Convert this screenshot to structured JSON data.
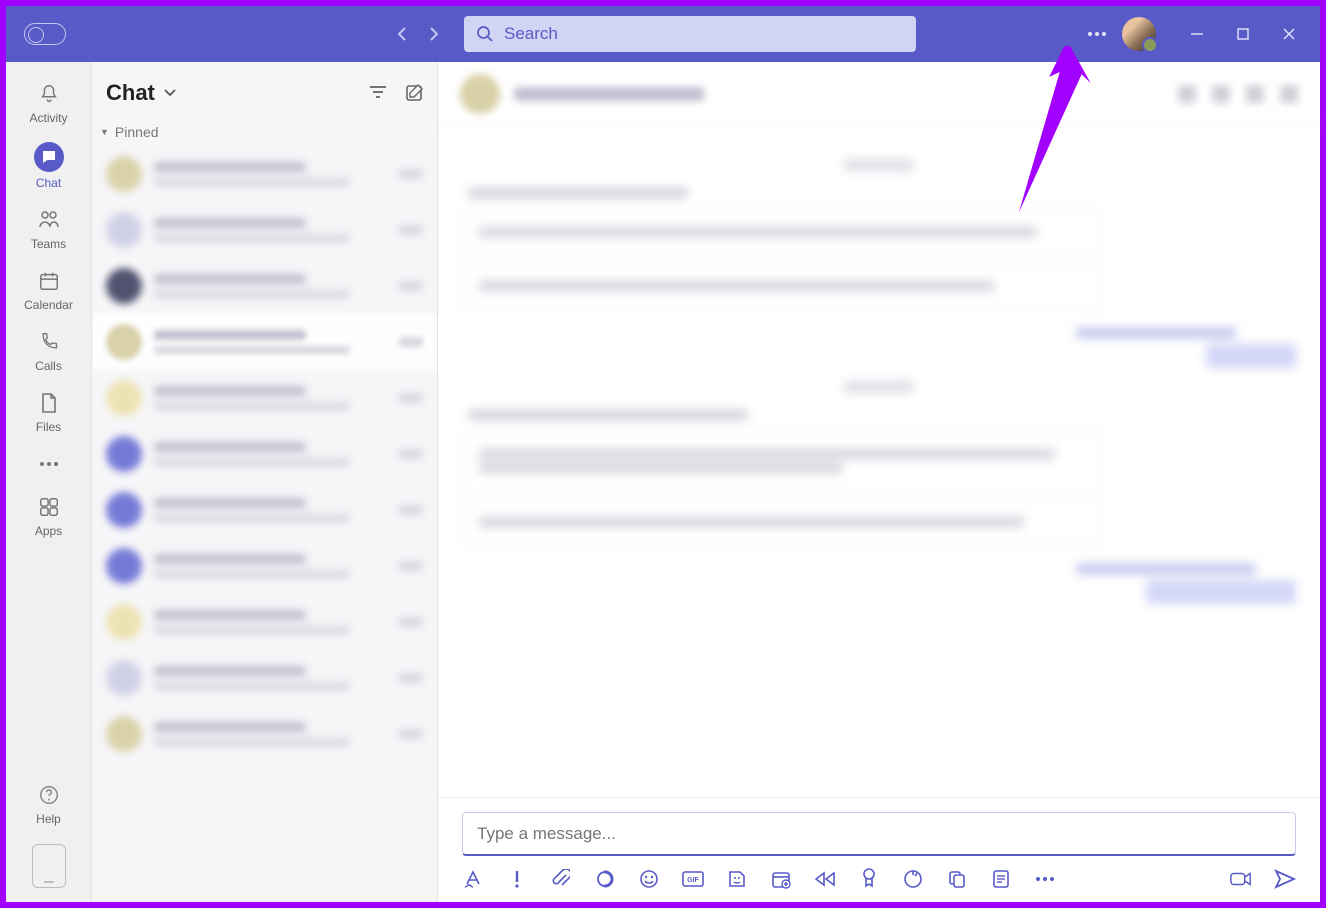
{
  "titlebar": {
    "search_placeholder": "Search",
    "more_dots": "⋅⋅⋅"
  },
  "rail": {
    "activity": "Activity",
    "chat": "Chat",
    "teams": "Teams",
    "calendar": "Calendar",
    "calls": "Calls",
    "files": "Files",
    "apps": "Apps",
    "help": "Help",
    "more": "•••"
  },
  "panel": {
    "title": "Chat",
    "section_pinned": "Pinned"
  },
  "compose": {
    "placeholder": "Type a message..."
  },
  "colors": {
    "brand": "#575ac7",
    "annotation": "#a100ff"
  }
}
